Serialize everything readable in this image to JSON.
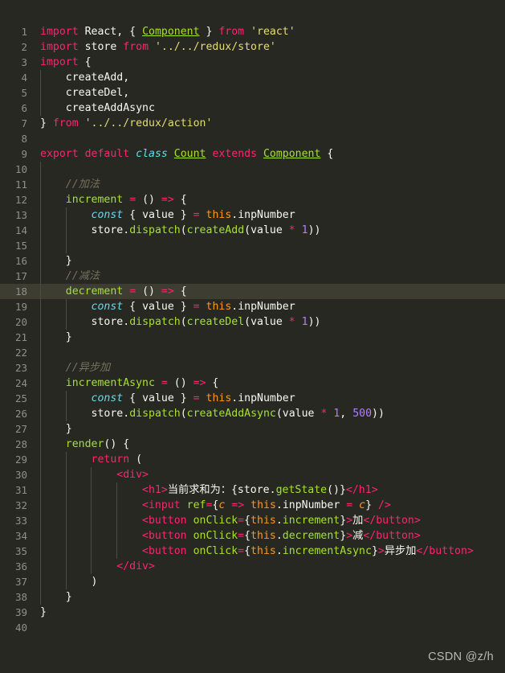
{
  "editor": {
    "theme_name": "monokai",
    "background_color": "#272822",
    "active_line_color": "#3e3d32",
    "gutter_color": "#8f908a",
    "language": "jsx",
    "active_line": 18,
    "total_lines": 40,
    "first_line": 1
  },
  "watermark": {
    "text": "CSDN @z/h"
  },
  "lines": [
    {
      "n": "1",
      "indent": 0,
      "text": "import React, { Component } from 'react'"
    },
    {
      "n": "2",
      "indent": 0,
      "text": "import store from '../../redux/store'"
    },
    {
      "n": "3",
      "indent": 0,
      "text": "import {"
    },
    {
      "n": "4",
      "indent": 1,
      "text": "    createAdd,"
    },
    {
      "n": "5",
      "indent": 1,
      "text": "    createDel,"
    },
    {
      "n": "6",
      "indent": 1,
      "text": "    createAddAsync"
    },
    {
      "n": "7",
      "indent": 0,
      "text": "} from '../../redux/action'"
    },
    {
      "n": "8",
      "indent": 0,
      "text": ""
    },
    {
      "n": "9",
      "indent": 0,
      "text": "export default class Count extends Component {"
    },
    {
      "n": "10",
      "indent": 1,
      "text": ""
    },
    {
      "n": "11",
      "indent": 1,
      "text": "    //加法"
    },
    {
      "n": "12",
      "indent": 1,
      "text": "    increment = () => {"
    },
    {
      "n": "13",
      "indent": 2,
      "text": "        const { value } = this.inpNumber"
    },
    {
      "n": "14",
      "indent": 2,
      "text": "        store.dispatch(createAdd(value * 1))"
    },
    {
      "n": "15",
      "indent": 2,
      "text": ""
    },
    {
      "n": "16",
      "indent": 1,
      "text": "    }"
    },
    {
      "n": "17",
      "indent": 1,
      "text": "    //减法"
    },
    {
      "n": "18",
      "indent": 1,
      "text": "    decrement = () => {"
    },
    {
      "n": "19",
      "indent": 2,
      "text": "        const { value } = this.inpNumber"
    },
    {
      "n": "20",
      "indent": 2,
      "text": "        store.dispatch(createDel(value * 1))"
    },
    {
      "n": "21",
      "indent": 1,
      "text": "    }"
    },
    {
      "n": "22",
      "indent": 1,
      "text": ""
    },
    {
      "n": "23",
      "indent": 1,
      "text": "    //异步加"
    },
    {
      "n": "24",
      "indent": 1,
      "text": "    incrementAsync = () => {"
    },
    {
      "n": "25",
      "indent": 2,
      "text": "        const { value } = this.inpNumber"
    },
    {
      "n": "26",
      "indent": 2,
      "text": "        store.dispatch(createAddAsync(value * 1, 500))"
    },
    {
      "n": "27",
      "indent": 1,
      "text": "    }"
    },
    {
      "n": "28",
      "indent": 1,
      "text": "    render() {"
    },
    {
      "n": "29",
      "indent": 2,
      "text": "        return ("
    },
    {
      "n": "30",
      "indent": 3,
      "text": "            <div>"
    },
    {
      "n": "31",
      "indent": 4,
      "text": "                <h1>当前求和为：{store.getState()}</h1>"
    },
    {
      "n": "32",
      "indent": 4,
      "text": "                <input ref={c => this.inpNumber = c} />"
    },
    {
      "n": "33",
      "indent": 4,
      "text": "                <button onClick={this.increment}>加</button>"
    },
    {
      "n": "34",
      "indent": 4,
      "text": "                <button onClick={this.decrement}>减</button>"
    },
    {
      "n": "35",
      "indent": 4,
      "text": "                <button onClick={this.incrementAsync}>异步加</button>"
    },
    {
      "n": "36",
      "indent": 3,
      "text": "            </div>"
    },
    {
      "n": "37",
      "indent": 2,
      "text": "        )"
    },
    {
      "n": "38",
      "indent": 1,
      "text": "    }"
    },
    {
      "n": "39",
      "indent": 0,
      "text": "}"
    },
    {
      "n": "40",
      "indent": 0,
      "text": ""
    }
  ],
  "tokens": {
    "keywords": [
      "import",
      "from",
      "export",
      "default",
      "extends",
      "return"
    ],
    "italic_keywords": [
      "class",
      "const"
    ],
    "strings": [
      "'react'",
      "'../../redux/store'",
      "'../../redux/action'"
    ],
    "numbers": [
      "1",
      "500"
    ],
    "comments": [
      "//加法",
      "//减法",
      "//异步加"
    ],
    "class_names": [
      "Count",
      "Component"
    ],
    "functions": [
      "increment",
      "decrement",
      "incrementAsync",
      "render",
      "dispatch",
      "getState",
      "createAdd",
      "createDel",
      "createAddAsync"
    ],
    "jsx_tags": [
      "div",
      "h1",
      "input",
      "button"
    ],
    "jsx_attributes": [
      "ref",
      "onClick"
    ],
    "jsx_text": [
      "当前求和为：",
      "加",
      "减",
      "异步加"
    ]
  }
}
